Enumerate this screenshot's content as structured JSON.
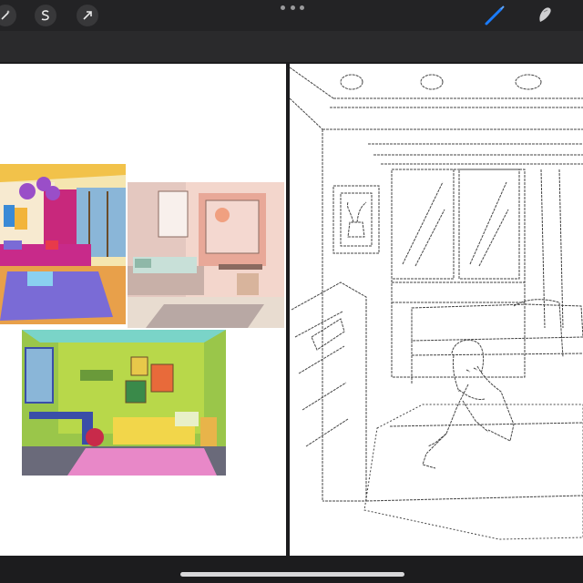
{
  "toolbar": {
    "left_icons": [
      "magic-wand-icon",
      "selection-s-icon",
      "transform-arrow-icon"
    ],
    "more_icon": "more-dots-icon",
    "right_icons": [
      "brush-icon",
      "smudge-icon"
    ],
    "accent": "#1a7cff"
  },
  "canvas": {
    "references": [
      {
        "name": "living-room-reference",
        "dominant_colors": [
          "#f2c24a",
          "#c82a8a",
          "#7a6bd6",
          "#3a5cc8"
        ]
      },
      {
        "name": "bedroom-pink-reference",
        "dominant_colors": [
          "#f0c2b8",
          "#d8b49c",
          "#8fb8a8"
        ]
      },
      {
        "name": "bedroom-green-reference",
        "dominant_colors": [
          "#9ac64a",
          "#f2d64a",
          "#e888c8",
          "#3a4ea8"
        ]
      }
    ],
    "sketch": {
      "name": "bedroom-girl-sketch",
      "stroke_color": "#444444"
    }
  }
}
